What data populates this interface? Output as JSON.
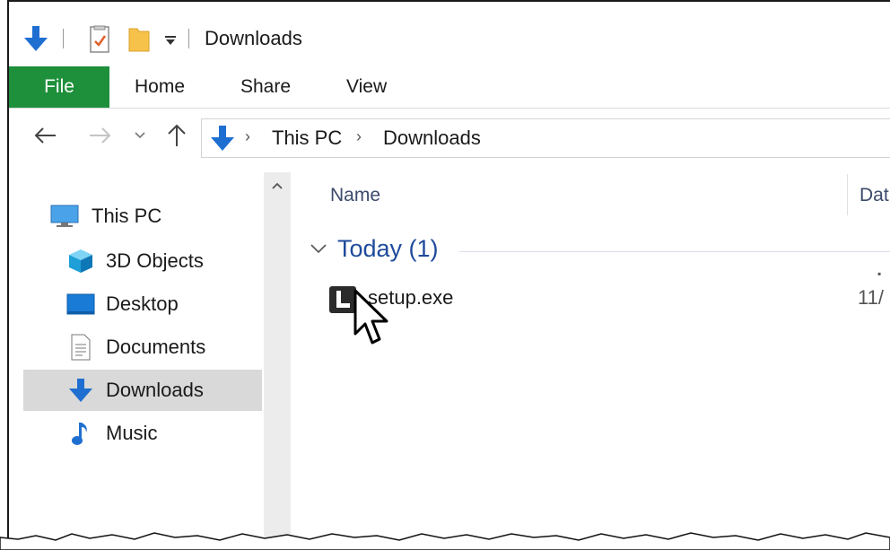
{
  "window": {
    "title": "Downloads"
  },
  "ribbon": {
    "tabs": [
      "File",
      "Home",
      "Share",
      "View"
    ]
  },
  "address": {
    "crumbs": [
      "This PC",
      "Downloads"
    ]
  },
  "nav": {
    "items": [
      {
        "label": "This PC",
        "icon": "monitor-icon"
      },
      {
        "label": "3D Objects",
        "icon": "cube-icon"
      },
      {
        "label": "Desktop",
        "icon": "desktop-icon"
      },
      {
        "label": "Documents",
        "icon": "document-icon"
      },
      {
        "label": "Downloads",
        "icon": "download-arrow-icon",
        "selected": true
      },
      {
        "label": "Music",
        "icon": "music-note-icon"
      }
    ]
  },
  "files": {
    "columns": {
      "name": "Name",
      "date": "Dat"
    },
    "group": {
      "label": "Today (1)"
    },
    "rows": [
      {
        "name": "setup.exe",
        "date": "11/"
      }
    ]
  },
  "colors": {
    "file_tab": "#1e8f3a",
    "accent_blue": "#1f6fd1",
    "group_text": "#1f4a9c",
    "selected_bg": "#d9d9d9"
  }
}
